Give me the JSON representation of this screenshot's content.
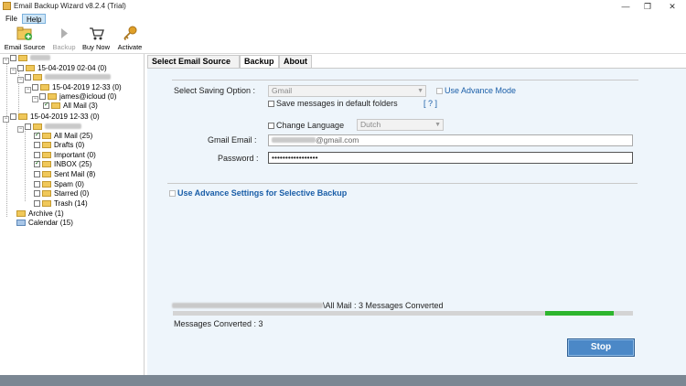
{
  "window": {
    "title": "Email Backup Wizard v8.2.4 (Trial)",
    "minimize": "—",
    "maximize": "❐",
    "close": "✕"
  },
  "menu": {
    "file": "File",
    "help": "Help"
  },
  "toolbar": {
    "email_source": "Email Source",
    "backup": "Backup",
    "buy_now": "Buy Now",
    "activate": "Activate"
  },
  "tree": {
    "root_label": "",
    "acct1_date": "15-04-2019 02-04 (0)",
    "acct1_sub_date": "15-04-2019 12-33 (0)",
    "james": "james@icloud",
    "james_count": "(0)",
    "all_mail_1": "All Mail (3)",
    "acct2_date": "15-04-2019 12-33 (0)",
    "folders": [
      {
        "label": "All Mail (25)",
        "checked": true
      },
      {
        "label": "Drafts (0)",
        "checked": false
      },
      {
        "label": "Important (0)",
        "checked": false
      },
      {
        "label": "INBOX (25)",
        "checked": true
      },
      {
        "label": "Sent Mail (8)",
        "checked": false
      },
      {
        "label": "Spam (0)",
        "checked": false
      },
      {
        "label": "Starred (0)",
        "checked": false
      },
      {
        "label": "Trash (14)",
        "checked": false
      }
    ],
    "archive": "Archive (1)",
    "calendar": "Calendar (15)"
  },
  "tabs": {
    "select_source": "Select Email Source",
    "backup": "Backup",
    "about": "About"
  },
  "form": {
    "saving_option_label": "Select Saving Option :",
    "saving_option_value": "Gmail",
    "use_advance_mode": "Use Advance Mode",
    "save_default_folders": "Save messages in default folders",
    "help_link": "[ ? ]",
    "change_language": "Change Language",
    "language_value": "Dutch",
    "gmail_label": "Gmail Email :",
    "gmail_suffix": "@gmail.com",
    "password_label": "Password :",
    "password_value": "•••••••••••••••••",
    "advance_settings": "Use Advance Settings for Selective Backup"
  },
  "status": {
    "path_suffix": "\\All Mail : 3 Messages Converted",
    "messages_converted": "Messages Converted : 3",
    "progress_fraction": 0.15
  },
  "actions": {
    "stop": "Stop"
  },
  "colors": {
    "accent": "#4b88c7",
    "progress": "#2db52d",
    "link": "#1a5ea8"
  }
}
